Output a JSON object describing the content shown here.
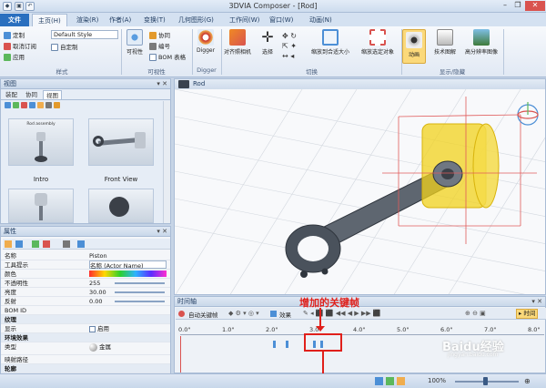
{
  "app": {
    "title": "3DVIA Composer - [Rod]",
    "qat_icons": [
      "save-icon",
      "undo-icon",
      "redo-icon"
    ],
    "window_controls": [
      "–",
      "❐",
      "✕"
    ]
  },
  "tabs": [
    {
      "label": "文件"
    },
    {
      "label": "主页(H)"
    },
    {
      "label": "渲染(R)"
    },
    {
      "label": "作者(A)"
    },
    {
      "label": "变换(T)"
    },
    {
      "label": "几何图形(G)"
    },
    {
      "label": "工作间(W)"
    },
    {
      "label": "窗口(W)"
    },
    {
      "label": "动画(N)"
    }
  ],
  "ribbon": {
    "style_group": {
      "define": "定制",
      "cancel_define": "取消订阅",
      "apply": "应用",
      "style_value": "Default Style",
      "custom_defined": "自定制",
      "group_label": "样式"
    },
    "visibility_group": {
      "visible": "可视性",
      "cooperate": "协同",
      "number": "编号",
      "bom_table": "BOM 表格",
      "group_label": "可视性"
    },
    "digger_group": {
      "digger": "Digger",
      "group_label": "Digger"
    },
    "switch_group": {
      "align_camera": "对齐照相机",
      "select": "选择",
      "zoom_fit": "缩放到合适大小",
      "zoom_selected": "缩放选定对象",
      "group_label": "切换"
    },
    "display_group": {
      "animation": "动画",
      "tech_illustration": "技术图解",
      "hires_image": "高分辨率图像",
      "group_label": "显示/隐藏"
    }
  },
  "view_panel": {
    "header": "视图",
    "subtabs": [
      "装配",
      "协同",
      "视图"
    ],
    "thumbnails": [
      {
        "label": "Intro",
        "title": "Rod assembly"
      },
      {
        "label": "Front View"
      },
      {
        "label": ""
      },
      {
        "label": ""
      }
    ]
  },
  "properties_panel": {
    "header": "属性",
    "rows": [
      {
        "name": "名称",
        "value": "Piston",
        "type": "row"
      },
      {
        "name": "工具提示",
        "value": "名称 (Actor Name)",
        "type": "row"
      },
      {
        "name": "颜色",
        "value": "",
        "type": "color"
      },
      {
        "name": "不透明性",
        "value": "255",
        "type": "row"
      },
      {
        "name": "亮度",
        "value": "30.00",
        "type": "row"
      },
      {
        "name": "反射",
        "value": "0.00",
        "type": "row"
      },
      {
        "name": "BOM ID",
        "value": "",
        "type": "row"
      },
      {
        "name": "纹理",
        "value": "",
        "type": "section"
      },
      {
        "name": "显示",
        "value": "启用",
        "type": "check"
      },
      {
        "name": "环境效果",
        "value": "",
        "type": "section"
      },
      {
        "name": "类型",
        "value": "金属",
        "type": "row"
      },
      {
        "name": "映射路径",
        "value": "",
        "type": "row"
      },
      {
        "name": "轮廓",
        "value": "",
        "type": "section"
      }
    ]
  },
  "viewport": {
    "tab_label": "Rod"
  },
  "timeline": {
    "header": "时间轴",
    "auto_keyframe": "自动关键帧",
    "effects": "效果",
    "time_label": "时间",
    "ticks": [
      "0.0\"",
      "1.0\"",
      "2.0\"",
      "3.0\"",
      "4.0\"",
      "5.0\"",
      "6.0\"",
      "7.0\"",
      "8.0\""
    ],
    "annotation": "增加的关键帧"
  },
  "statusbar": {
    "zoom": "100%"
  },
  "watermark": "Baidu经验",
  "watermark_url": "jingyan.baidu.com",
  "colors": {
    "ribbon_blue": "#2a6fbf",
    "annotation_red": "#e0201b",
    "piston_yellow": "#f2d21c"
  }
}
